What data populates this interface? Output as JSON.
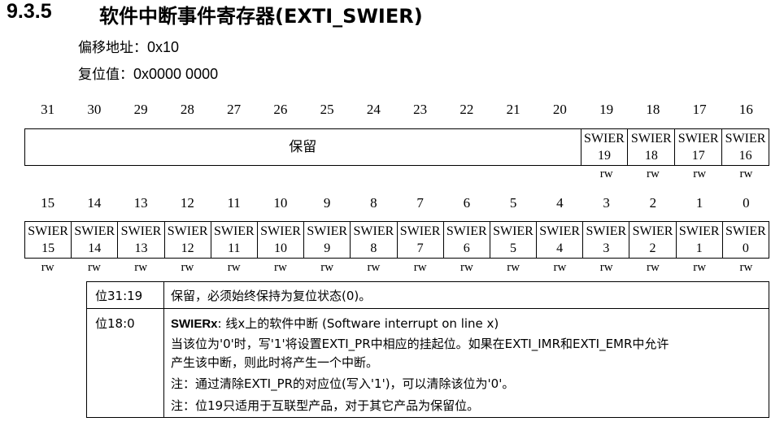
{
  "section": {
    "number": "9.3.5",
    "title": "软件中断事件寄存器(EXTI_SWIER)"
  },
  "meta": {
    "offset_label": "偏移地址：",
    "offset_value": "0x10",
    "reset_label": "复位值：",
    "reset_value": "0x0000 0000"
  },
  "upper_bits": [
    "31",
    "30",
    "29",
    "28",
    "27",
    "26",
    "25",
    "24",
    "23",
    "22",
    "21",
    "20",
    "19",
    "18",
    "17",
    "16"
  ],
  "upper_reserved_label": "保留",
  "upper_fields": [
    {
      "name": "SWIER",
      "num": "19",
      "access": "rw"
    },
    {
      "name": "SWIER",
      "num": "18",
      "access": "rw"
    },
    {
      "name": "SWIER",
      "num": "17",
      "access": "rw"
    },
    {
      "name": "SWIER",
      "num": "16",
      "access": "rw"
    }
  ],
  "lower_bits": [
    "15",
    "14",
    "13",
    "12",
    "11",
    "10",
    "9",
    "8",
    "7",
    "6",
    "5",
    "4",
    "3",
    "2",
    "1",
    "0"
  ],
  "lower_fields": [
    {
      "name": "SWIER",
      "num": "15",
      "access": "rw"
    },
    {
      "name": "SWIER",
      "num": "14",
      "access": "rw"
    },
    {
      "name": "SWIER",
      "num": "13",
      "access": "rw"
    },
    {
      "name": "SWIER",
      "num": "12",
      "access": "rw"
    },
    {
      "name": "SWIER",
      "num": "11",
      "access": "rw"
    },
    {
      "name": "SWIER",
      "num": "10",
      "access": "rw"
    },
    {
      "name": "SWIER",
      "num": "9",
      "access": "rw"
    },
    {
      "name": "SWIER",
      "num": "8",
      "access": "rw"
    },
    {
      "name": "SWIER",
      "num": "7",
      "access": "rw"
    },
    {
      "name": "SWIER",
      "num": "6",
      "access": "rw"
    },
    {
      "name": "SWIER",
      "num": "5",
      "access": "rw"
    },
    {
      "name": "SWIER",
      "num": "4",
      "access": "rw"
    },
    {
      "name": "SWIER",
      "num": "3",
      "access": "rw"
    },
    {
      "name": "SWIER",
      "num": "2",
      "access": "rw"
    },
    {
      "name": "SWIER",
      "num": "1",
      "access": "rw"
    },
    {
      "name": "SWIER",
      "num": "0",
      "access": "rw"
    }
  ],
  "descriptions": {
    "row1": {
      "bits": "位31:19",
      "text": "保留，必须始终保持为复位状态(0)。"
    },
    "row2": {
      "bits": "位18:0",
      "field_name": "SWIERx",
      "field_title": ": 线x上的软件中断 (Software interrupt on line x)",
      "line1": "当该位为'0'时，写'1'将设置EXTI_PR中相应的挂起位。如果在EXTI_IMR和EXTI_EMR中允许",
      "line2": "产生该中断，则此时将产生一个中断。",
      "note1": "注：通过清除EXTI_PR的对应位(写入'1')，可以清除该位为'0'。",
      "note2": "注：位19只适用于互联型产品，对于其它产品为保留位。"
    }
  }
}
